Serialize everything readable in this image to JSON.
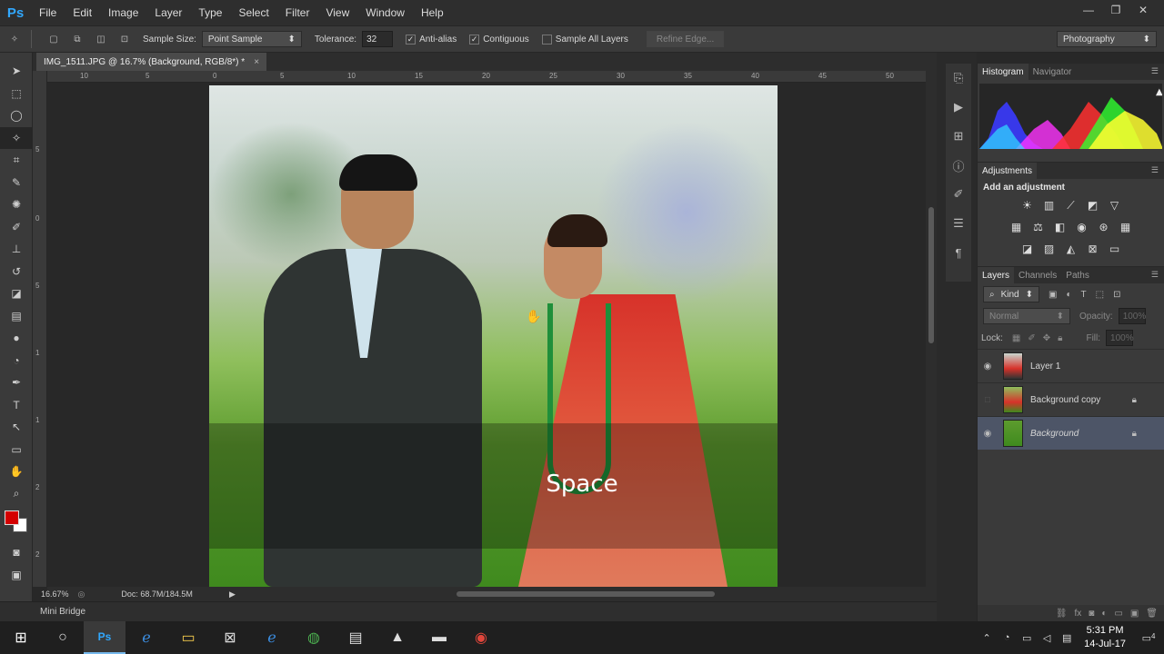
{
  "app": {
    "logo": "Ps"
  },
  "menu": [
    "File",
    "Edit",
    "Image",
    "Layer",
    "Type",
    "Select",
    "Filter",
    "View",
    "Window",
    "Help"
  ],
  "window_controls": [
    "—",
    "❐",
    "✕"
  ],
  "options": {
    "sample_size_label": "Sample Size:",
    "sample_size_value": "Point Sample",
    "tolerance_label": "Tolerance:",
    "tolerance_value": "32",
    "anti_alias_label": "Anti-alias",
    "anti_alias_checked": true,
    "contiguous_label": "Contiguous",
    "contiguous_checked": true,
    "sample_all_layers_label": "Sample All Layers",
    "sample_all_layers_checked": false,
    "refine_edge_label": "Refine Edge...",
    "workspace_value": "Photography"
  },
  "document": {
    "tab_title": "IMG_1511.JPG @ 16.7% (Background, RGB/8*) *",
    "close": "×",
    "ruler_h": [
      "10",
      "5",
      "0",
      "5",
      "10",
      "15",
      "20",
      "25",
      "30",
      "35",
      "40",
      "45",
      "50"
    ],
    "ruler_v": [
      "5",
      "0",
      "5",
      "1",
      "1",
      "2",
      "2",
      "3"
    ],
    "overlay_text": "Space",
    "zoom": "16.67%",
    "doc_size": "Doc: 68.7M/184.5M"
  },
  "mini_bridge": "Mini Bridge",
  "panels": {
    "histogram_tabs": [
      "Histogram",
      "Navigator"
    ],
    "adjustments_tab": "Adjustments",
    "add_adjustment": "Add an adjustment",
    "layers_tabs": [
      "Layers",
      "Channels",
      "Paths"
    ],
    "kind_label": "Kind",
    "blend_mode": "Normal",
    "opacity_label": "Opacity:",
    "opacity_value": "100%",
    "lock_label": "Lock:",
    "fill_label": "Fill:",
    "fill_value": "100%",
    "layers": [
      {
        "name": "Layer 1",
        "visible": true,
        "locked": false
      },
      {
        "name": "Background copy",
        "visible": false,
        "locked": true
      },
      {
        "name": "Background",
        "visible": true,
        "locked": true
      }
    ]
  },
  "taskbar": {
    "time": "5:31 PM",
    "date": "14-Jul-17",
    "notification_count": "4"
  },
  "colors": {
    "ps_blue": "#31a8ff",
    "foreground": "#d40000",
    "background": "#ffffff",
    "selected_layer": "#4d5567"
  }
}
